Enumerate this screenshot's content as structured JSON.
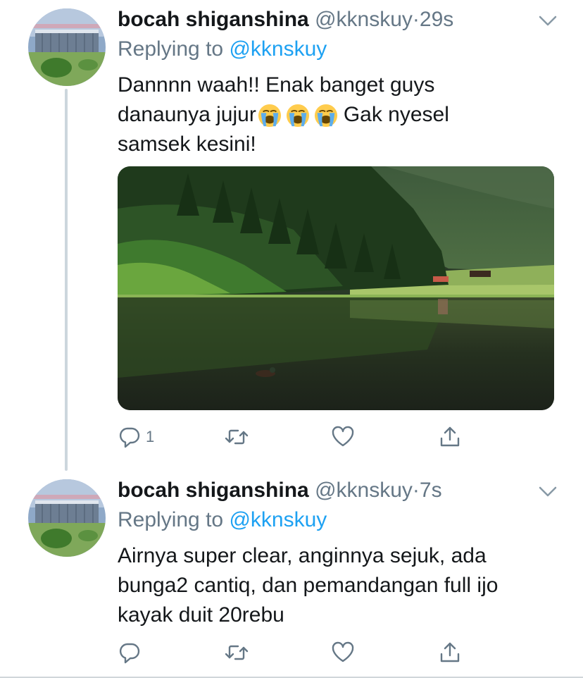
{
  "tweets": [
    {
      "author_name": "bocah shiganshina",
      "author_handle": "@kknskuy",
      "separator": "·",
      "time": "29s",
      "replying_prefix": "Replying to",
      "replying_to": "@kknskuy",
      "text_line1": "Dannnn waah!! Enak banget guys",
      "text_line2_before": "danaunya jujur",
      "emoji": "loudly-crying-face",
      "emoji_count": 3,
      "text_line2_after": "Gak nyesel",
      "text_line3": "samsek kesini!",
      "media": "lake-with-forest-and-duck-photo",
      "reply_count": "1",
      "icons": [
        "reply-icon",
        "retweet-icon",
        "like-icon",
        "share-icon"
      ]
    },
    {
      "author_name": "bocah shiganshina",
      "author_handle": "@kknskuy",
      "separator": "·",
      "time": "7s",
      "replying_prefix": "Replying to",
      "replying_to": "@kknskuy",
      "text_line1": "Airnya super clear, anginnya sejuk, ada",
      "text_line2": "bunga2 cantiq, dan pemandangan full ijo",
      "text_line3": "kayak duit 20rebu",
      "reply_count": "",
      "icons": [
        "reply-icon",
        "retweet-icon",
        "like-icon",
        "share-icon"
      ]
    }
  ],
  "colors": {
    "text": "#14171a",
    "secondary": "#657786",
    "accent": "#1da1f2",
    "thread_line": "#ccd6dd"
  }
}
